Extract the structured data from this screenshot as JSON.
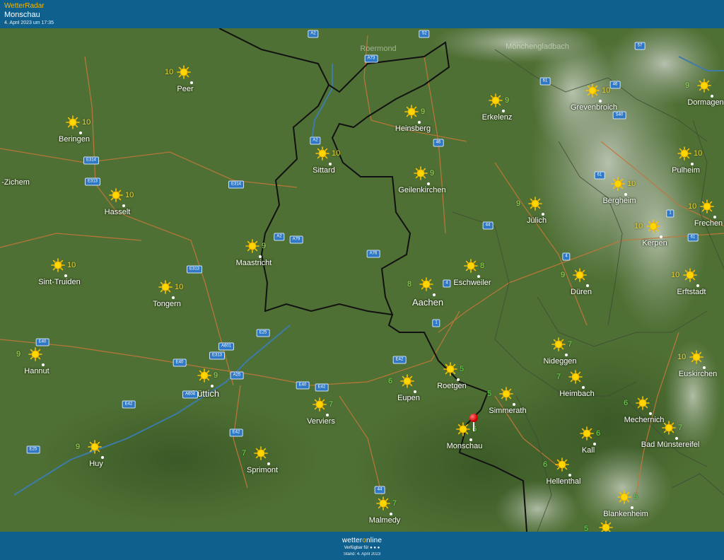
{
  "header": {
    "brand": "WetterRadar",
    "location": "Monschau",
    "timestamp": "4. April 2023 um 17:35"
  },
  "footer": {
    "logo_prefix": "wetter",
    "logo_o": "o",
    "logo_suffix": "nline",
    "available": "Verfügbar für ● ● ●",
    "stand": "Stand: 4. April 2023"
  },
  "colors": {
    "header_bg": "#10608e",
    "brand": "#f5b800",
    "map_green": "#4d6e33",
    "road_sign": "#2f78c5",
    "pin": "#d40000"
  },
  "cities": [
    {
      "name": "Peer",
      "temp": "10"
    },
    {
      "name": "Beringen",
      "temp": "10"
    },
    {
      "name": "-Zichem",
      "temp": ""
    },
    {
      "name": "Hasselt",
      "temp": "10"
    },
    {
      "name": "Sint-Truiden",
      "temp": "10"
    },
    {
      "name": "Tongern",
      "temp": "10"
    },
    {
      "name": "Hannut",
      "temp": "9"
    },
    {
      "name": "Lüttich",
      "temp": "9"
    },
    {
      "name": "Huy",
      "temp": "9"
    },
    {
      "name": "Sprimont",
      "temp": "7"
    },
    {
      "name": "Verviers",
      "temp": "7"
    },
    {
      "name": "Malmedy",
      "temp": "7"
    },
    {
      "name": "Eupen",
      "temp": "6"
    },
    {
      "name": "Maastricht",
      "temp": "9"
    },
    {
      "name": "Sittard",
      "temp": "10"
    },
    {
      "name": "Aachen",
      "temp": "8"
    },
    {
      "name": "Heinsberg",
      "temp": "9"
    },
    {
      "name": "Geilenkirchen",
      "temp": "9"
    },
    {
      "name": "Erkelenz",
      "temp": "9"
    },
    {
      "name": "Eschweiler",
      "temp": "8"
    },
    {
      "name": "Roetgen",
      "temp": "5"
    },
    {
      "name": "Simmerath",
      "temp": "5"
    },
    {
      "name": "Monschau",
      "temp": "6"
    },
    {
      "name": "Hellenthal",
      "temp": "6"
    },
    {
      "name": "Jülich",
      "temp": "9"
    },
    {
      "name": "Düren",
      "temp": "9"
    },
    {
      "name": "Nideggen",
      "temp": "7"
    },
    {
      "name": "Heimbach",
      "temp": "7"
    },
    {
      "name": "Kall",
      "temp": "6"
    },
    {
      "name": "Grevenbroich",
      "temp": "10"
    },
    {
      "name": "Bergheim",
      "temp": "10"
    },
    {
      "name": "Kerpen",
      "temp": "10"
    },
    {
      "name": "Erftstadt",
      "temp": "10"
    },
    {
      "name": "Dormagen",
      "temp": "9"
    },
    {
      "name": "Pulheim",
      "temp": "10"
    },
    {
      "name": "Frechen",
      "temp": "10"
    },
    {
      "name": "Euskirchen",
      "temp": "10"
    },
    {
      "name": "Mechernich",
      "temp": "6"
    },
    {
      "name": "Bad Münstereifel",
      "temp": "7"
    },
    {
      "name": "Blankenheim",
      "temp": "5"
    }
  ],
  "faded_labels": [
    "Roermond",
    "Mönchengladbach"
  ],
  "roads": [
    "A2",
    "A73",
    "S2",
    "57",
    "61",
    "46",
    "S40",
    "A2",
    "46",
    "E314",
    "E313",
    "E314",
    "A2",
    "A79",
    "A76",
    "44",
    "4",
    "4",
    "61",
    "1",
    "E313",
    "E25",
    "E40",
    "A601",
    "E313",
    "A25",
    "A604",
    "E40",
    "E40",
    "E42",
    "E42",
    "E42",
    "E25",
    "E42",
    "44",
    "1",
    "61"
  ],
  "extra_temps": [
    "5"
  ]
}
